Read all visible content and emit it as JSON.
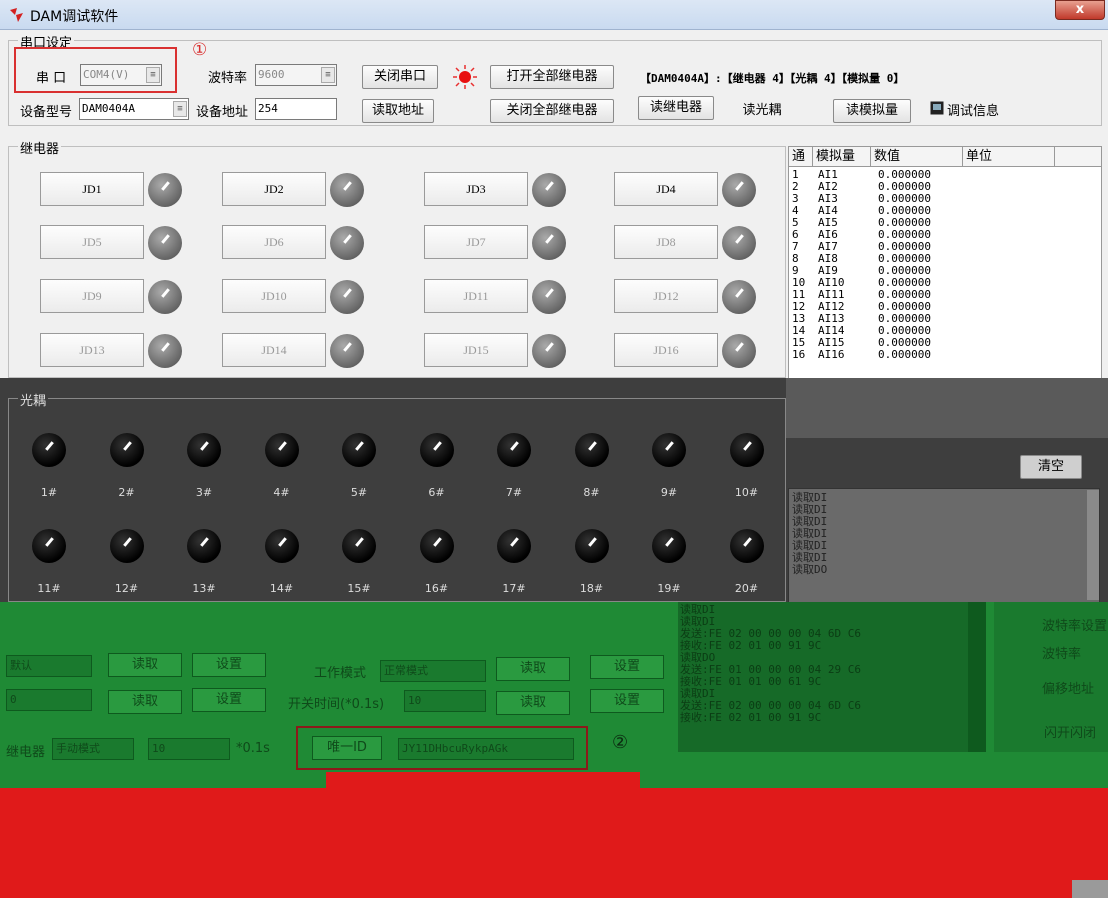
{
  "window": {
    "title": "DAM调试软件",
    "close_label": "x"
  },
  "serial": {
    "group_label": "串口设定",
    "port_label": "串  口",
    "port_value": "COM4(V)",
    "baud_label": "波特率",
    "baud_value": "9600",
    "close_port_btn": "关闭串口",
    "open_all_btn": "打开全部继电器",
    "device_info": "【DAM0404A】:【继电器  4】【光耦 4】【模拟量 0】",
    "model_label": "设备型号",
    "model_value": "DAM0404A",
    "addr_label": "设备地址",
    "addr_value": "254",
    "read_addr_btn": "读取地址",
    "close_all_btn": "关闭全部继电器",
    "read_relay_btn": "读继电器",
    "read_opto_btn": "读光耦",
    "read_analog_btn": "读模拟量",
    "debug_label": "调试信息"
  },
  "relays": {
    "group_label": "继电器",
    "items": [
      "JD1",
      "JD2",
      "JD3",
      "JD4",
      "JD5",
      "JD6",
      "JD7",
      "JD8",
      "JD9",
      "JD10",
      "JD11",
      "JD12",
      "JD13",
      "JD14",
      "JD15",
      "JD16"
    ]
  },
  "optocouplers": {
    "group_label": "光耦",
    "items": [
      "1#",
      "2#",
      "3#",
      "4#",
      "5#",
      "6#",
      "7#",
      "8#",
      "9#",
      "10#",
      "11#",
      "12#",
      "13#",
      "14#",
      "15#",
      "16#",
      "17#",
      "18#",
      "19#",
      "20#"
    ]
  },
  "analog_table": {
    "headers": [
      "通",
      "模拟量",
      "数值",
      "单位"
    ],
    "rows": [
      [
        "1",
        "AI1",
        "0.000000"
      ],
      [
        "2",
        "AI2",
        "0.000000"
      ],
      [
        "3",
        "AI3",
        "0.000000"
      ],
      [
        "4",
        "AI4",
        "0.000000"
      ],
      [
        "5",
        "AI5",
        "0.000000"
      ],
      [
        "6",
        "AI6",
        "0.000000"
      ],
      [
        "7",
        "AI7",
        "0.000000"
      ],
      [
        "8",
        "AI8",
        "0.000000"
      ],
      [
        "9",
        "AI9",
        "0.000000"
      ],
      [
        "10",
        "AI10",
        "0.000000"
      ],
      [
        "11",
        "AI11",
        "0.000000"
      ],
      [
        "12",
        "AI12",
        "0.000000"
      ],
      [
        "13",
        "AI13",
        "0.000000"
      ],
      [
        "14",
        "AI14",
        "0.000000"
      ],
      [
        "15",
        "AI15",
        "0.000000"
      ],
      [
        "16",
        "AI16",
        "0.000000"
      ]
    ],
    "clear_btn": "清空"
  },
  "log_upper": "读取DI\n读取DI\n读取DI\n读取DI\n读取DI\n读取DI\n读取DO",
  "log_lower": "读取DI\n读取DI\n发送:FE 02 00 00 00 04 6D C6\n接收:FE 02 01 00 91 9C\n读取DO\n发送:FE 01 00 00 00 04 29 C6\n接收:FE 01 01 00 61 9C\n读取DI\n发送:FE 02 00 00 00 04 6D C6\n接收:FE 02 01 00 91 9C",
  "green_panel": {
    "default_value": "默认",
    "read": "读取",
    "set": "设置",
    "work_mode_label": "工作模式",
    "work_mode_value": "正常模式",
    "switch_time_label": "开关时间(*0.1s)",
    "switch_time_value": "10",
    "relay_label": "继电器",
    "relay_mode_value": "手动模式",
    "relay_time_value": "10",
    "relay_unit": "*0.1s",
    "uid_btn": "唯一ID",
    "uid_value": "JY11DHbcuRykpAGk",
    "zero_value": "0",
    "right_labels": [
      "波特率设置",
      "波特率",
      "偏移地址",
      "闪开闪闭"
    ]
  },
  "annotations": {
    "one": "①",
    "two": "②"
  },
  "colors": {
    "annotation_red": "#d93030",
    "annotation_brown": "#8b1a1a"
  }
}
